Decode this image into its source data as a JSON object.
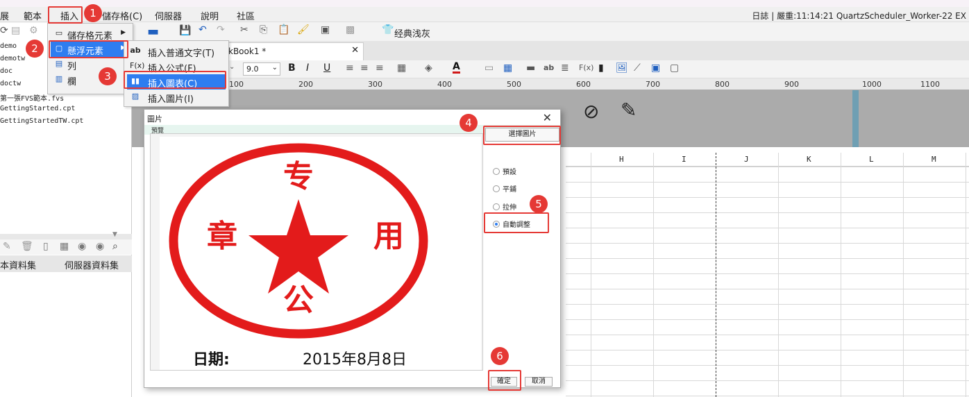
{
  "menubar": {
    "items": [
      "展",
      "範本",
      "插入",
      "儲存格(C)",
      "伺服器",
      "說明",
      "社區"
    ],
    "log_text": "日誌 | 嚴重:11:14:21 QuartzScheduler_Worker-22 EX"
  },
  "left_panel": {
    "files": [
      "demo",
      "demotw",
      "doc",
      "doctw",
      "第一張FVS範本.fvs",
      "GettingStarted.cpt",
      "GettingStartedTW.cpt"
    ],
    "dataset_tabs": [
      "本資料集",
      "伺服器資料集"
    ]
  },
  "toolbar": {
    "theme_label": "经典浅灰",
    "tab_name": "kBook1 *",
    "font_size": "9.0"
  },
  "ruler": {
    "ticks": [
      "100",
      "200",
      "300",
      "400",
      "500",
      "600",
      "700",
      "800",
      "900",
      "1000",
      "1100"
    ]
  },
  "columns": [
    "H",
    "I",
    "J",
    "K",
    "L",
    "M"
  ],
  "insert_menu": {
    "items": [
      "儲存格元素",
      "懸浮元素",
      "列",
      "欄"
    ]
  },
  "float_submenu": {
    "items": [
      "插入普通文字(T)",
      "插入公式(F)",
      "插入圖表(C)",
      "插入圖片(I)"
    ],
    "icons": [
      "ab",
      "F(x)",
      "bar-chart",
      "picture"
    ]
  },
  "dialog": {
    "title": "圖片",
    "preview_label": "預覽",
    "select_image_button": "選擇圖片",
    "options": [
      "預設",
      "平鋪",
      "拉伸",
      "自動調整"
    ],
    "selected_option": "自動調整",
    "ok_button": "確定",
    "cancel_button": "取消"
  },
  "stamp": {
    "top": "专",
    "left": "章",
    "right": "用",
    "bottom": "公",
    "date_label": "日期:",
    "date_value": "2015年8月8日",
    "color": "#e31b1b"
  },
  "badges": [
    "1",
    "2",
    "3",
    "4",
    "5",
    "6"
  ],
  "colors": {
    "accent_red": "#e53935",
    "selection_blue": "#2e7df0"
  }
}
